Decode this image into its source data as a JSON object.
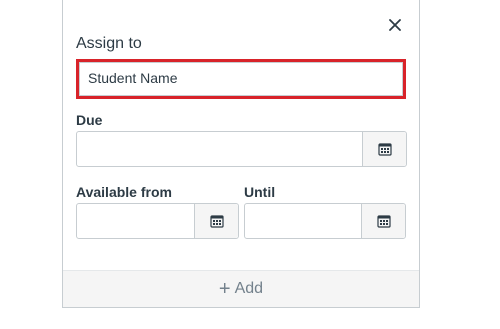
{
  "assign": {
    "label": "Assign to",
    "value": "Student Name"
  },
  "due": {
    "label": "Due",
    "value": ""
  },
  "available_from": {
    "label": "Available from",
    "value": ""
  },
  "until": {
    "label": "Until",
    "value": ""
  },
  "footer": {
    "add_label": "Add",
    "add_icon": "+"
  },
  "colors": {
    "highlight": "#d8232a",
    "text": "#2d3b45",
    "muted": "#73818c"
  }
}
